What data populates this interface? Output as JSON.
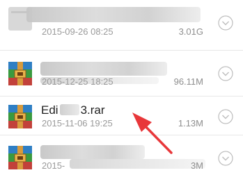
{
  "files": [
    {
      "name": "",
      "date": "2015-09-26 08:25",
      "size": "3.01G",
      "icon": "generic-file-icon"
    },
    {
      "name": "",
      "date": "2015-12-25 18:25",
      "size": "96.11M",
      "icon": "winrar-archive-icon"
    },
    {
      "name": "Edi 3.rar",
      "name_start": "Edi",
      "name_end": "3.rar",
      "date": "2015-11-06 19:25",
      "size": "1.13M",
      "icon": "winrar-archive-icon"
    },
    {
      "name": "",
      "date": "2015-",
      "size": "3M",
      "icon": "winrar-archive-icon"
    }
  ],
  "annotation": {
    "icon": "red-arrow-icon",
    "color": "#e8373a"
  },
  "colors": {
    "text": "#1f1f1f",
    "meta": "#9a9a9a",
    "separator": "#e7e7e7"
  }
}
